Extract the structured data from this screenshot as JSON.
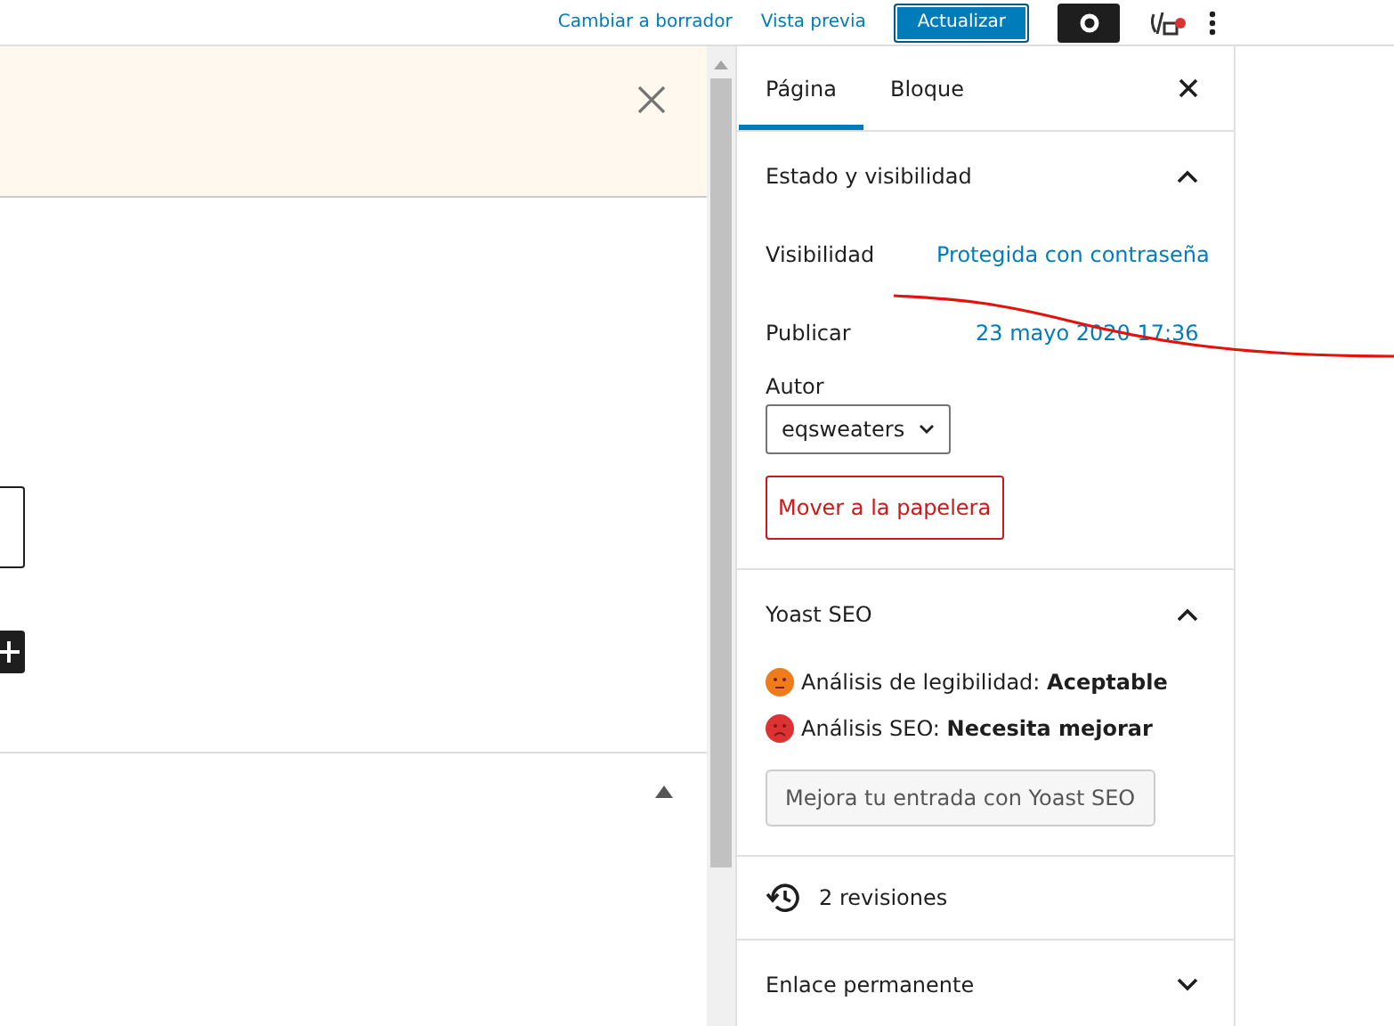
{
  "toolbar": {
    "links": [
      "Cambiar a borrador",
      "Vista previa"
    ],
    "primary_button": "Actualizar"
  },
  "sidebar": {
    "tabs": [
      {
        "label": "Página",
        "selected": true
      },
      {
        "label": "Bloque",
        "selected": false
      }
    ],
    "panels": [
      {
        "kind": "status",
        "title": "Estado y visibilidad",
        "expanded": true,
        "rows": [
          {
            "label": "Visibilidad",
            "value": "Protegida con contraseña"
          },
          {
            "label": "Publicar",
            "value": "23 mayo 2020 17:36"
          }
        ],
        "author_label": "Autor",
        "author": "eqsweaters",
        "trash": "Mover a la papelera"
      },
      {
        "kind": "yoast",
        "title": "Yoast SEO",
        "expanded": true,
        "analyses": [
          {
            "label": "Análisis de legibilidad:",
            "result": "Aceptable",
            "color": "#ee7c1b",
            "kind": "neutral"
          },
          {
            "label": "Análisis SEO:",
            "result": "Necesita mejorar",
            "color": "#dc3232",
            "kind": "sad"
          }
        ],
        "button": "Mejora tu entrada con Yoast SEO"
      },
      {
        "kind": "revisions",
        "title": "2 revisiones"
      },
      {
        "kind": "permalink",
        "title": "Enlace permanente",
        "expanded": false
      }
    ]
  }
}
